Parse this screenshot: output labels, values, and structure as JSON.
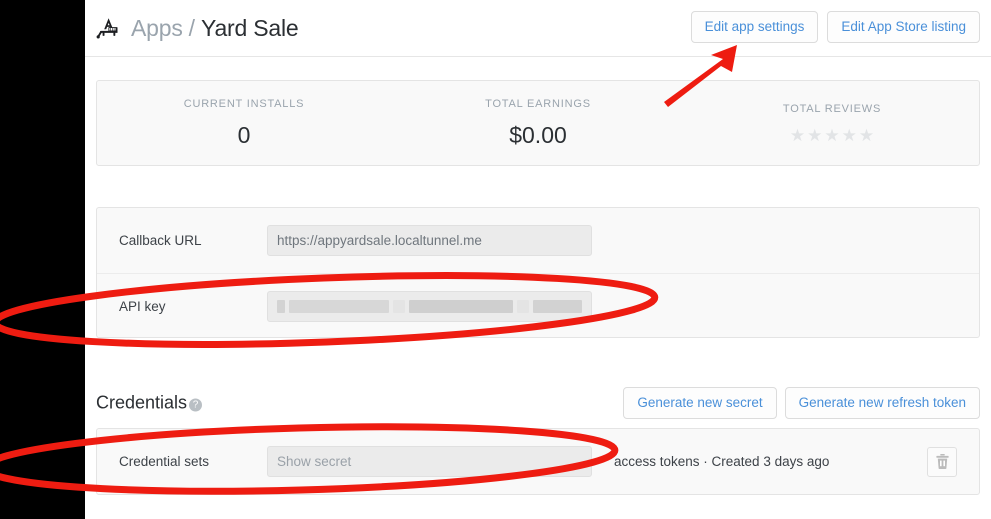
{
  "window": {
    "letterbox_color": "#000000",
    "background": "#ffffff"
  },
  "header": {
    "app_icon": "app-store-icon",
    "breadcrumb_root": "Apps",
    "breadcrumb_separator": "/",
    "breadcrumb_current": "Yard Sale",
    "buttons": [
      {
        "label": "Edit app settings",
        "name": "edit-app-settings-button"
      },
      {
        "label": "Edit App Store listing",
        "name": "edit-app-store-listing-button"
      }
    ]
  },
  "stats": {
    "items": [
      {
        "label": "CURRENT INSTALLS",
        "value": "0",
        "type": "text"
      },
      {
        "label": "TOTAL EARNINGS",
        "value": "$0.00",
        "type": "text"
      },
      {
        "label": "TOTAL REVIEWS",
        "value": "",
        "type": "stars",
        "stars_total": 5,
        "stars_filled": 0
      }
    ]
  },
  "settings": {
    "rows": [
      {
        "label": "Callback URL",
        "value": "https://appyardsale.localtunnel.me",
        "name": "callback-url",
        "redacted": false
      },
      {
        "label": "API key",
        "value": "",
        "name": "api-key",
        "redacted": true
      }
    ]
  },
  "credentials": {
    "heading": "Credentials",
    "help_icon": "question-mark-icon",
    "buttons": [
      {
        "label": "Generate new secret",
        "name": "generate-new-secret-button"
      },
      {
        "label": "Generate new refresh token",
        "name": "generate-new-refresh-token-button"
      }
    ],
    "row": {
      "label": "Credential sets",
      "secret_field_placeholder": "Show secret",
      "meta": "access tokens · Created 3 days ago",
      "delete_icon": "trash-icon"
    }
  },
  "annotations": {
    "accent_color": "#ee1c11",
    "arrow": {
      "name": "red-arrow-annotation",
      "points_to": "edit-app-settings-button"
    },
    "ellipses": [
      {
        "name": "red-ellipse-api-key-annotation",
        "highlights": "api-key-row"
      },
      {
        "name": "red-ellipse-credential-sets-annotation",
        "highlights": "credential-sets-row"
      }
    ]
  }
}
